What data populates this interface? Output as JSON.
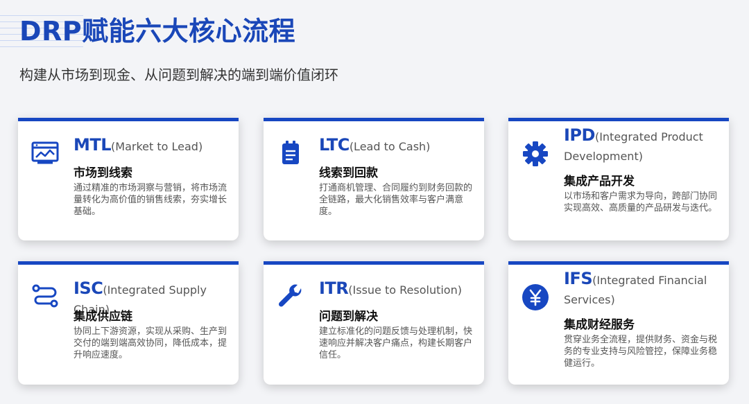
{
  "header": {
    "title": "DRP赋能六大核心流程",
    "subtitle": "构建从市场到现金、从问题到解决的端到端价值闭环"
  },
  "accent_color": "#1747c2",
  "cards": [
    {
      "abbr": "MTL",
      "full": "(Market to Lead)",
      "cn": "市场到线索",
      "desc": "通过精准的市场洞察与营销，将市场流量转化为高价值的销售线索，夯实增长基础。",
      "icon": "presentation-chart-icon"
    },
    {
      "abbr": "LTC",
      "full": "(Lead to Cash)",
      "cn": "线索到回款",
      "desc": "打通商机管理、合同履约到财务回款的全链路，最大化销售效率与客户满意度。",
      "icon": "clipboard-icon"
    },
    {
      "abbr": "IPD",
      "full": "(Integrated Product Development)",
      "cn": "集成产品开发",
      "desc": "以市场和客户需求为导向，跨部门协同实现高效、高质量的产品研发与迭代。",
      "icon": "gear-icon"
    },
    {
      "abbr": "ISC",
      "full": "(Integrated Supply Chain)",
      "cn": "集成供应链",
      "desc": "协同上下游资源，实现从采购、生产到交付的端到端高效协同，降低成本，提升响应速度。",
      "icon": "route-icon"
    },
    {
      "abbr": "ITR",
      "full": "(Issue to Resolution)",
      "cn": "问题到解决",
      "desc": "建立标准化的问题反馈与处理机制，快速响应并解决客户痛点，构建长期客户信任。",
      "icon": "wrench-icon"
    },
    {
      "abbr": "IFS",
      "full": "(Integrated Financial Services)",
      "cn": "集成财经服务",
      "desc": "贯穿业务全流程，提供财务、资金与税务的专业支持与风险管控，保障业务稳健运行。",
      "icon": "yen-coin-icon"
    }
  ]
}
